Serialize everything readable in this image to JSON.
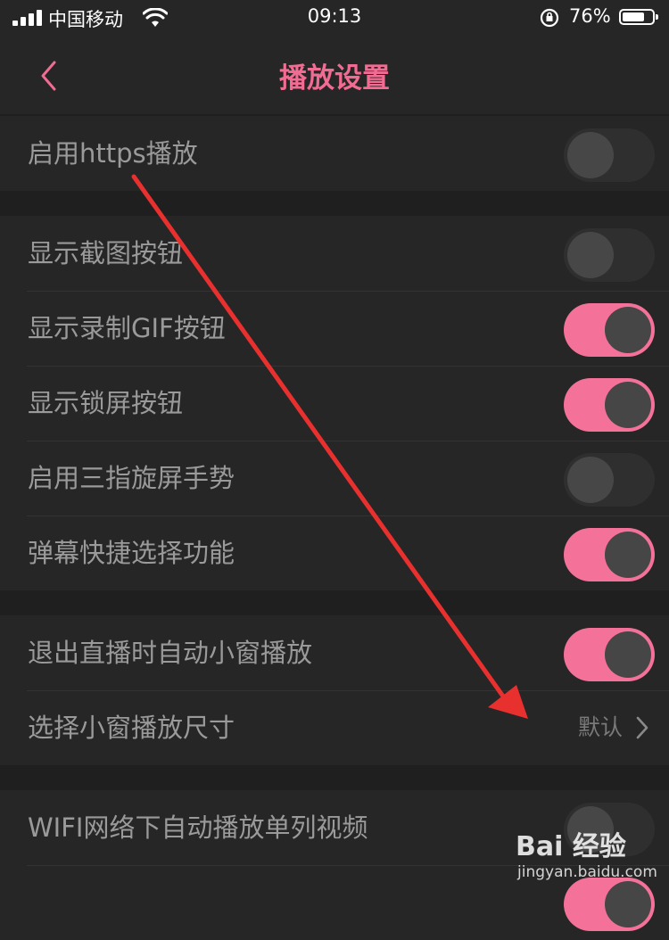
{
  "status_bar": {
    "carrier": "中国移动",
    "time": "09:13",
    "battery_percent": "76%",
    "battery_level": 0.76
  },
  "nav": {
    "title": "播放设置",
    "back_icon": "chevron-left-icon"
  },
  "groups": [
    {
      "rows": [
        {
          "label": "启用https播放",
          "type": "toggle",
          "on": false
        }
      ]
    },
    {
      "rows": [
        {
          "label": "显示截图按钮",
          "type": "toggle",
          "on": false
        },
        {
          "label": "显示录制GIF按钮",
          "type": "toggle",
          "on": true
        },
        {
          "label": "显示锁屏按钮",
          "type": "toggle",
          "on": true
        },
        {
          "label": "启用三指旋屏手势",
          "type": "toggle",
          "on": false
        },
        {
          "label": "弹幕快捷选择功能",
          "type": "toggle",
          "on": true
        }
      ]
    },
    {
      "rows": [
        {
          "label": "退出直播时自动小窗播放",
          "type": "toggle",
          "on": true
        },
        {
          "label": "选择小窗播放尺寸",
          "type": "select",
          "value": "默认"
        }
      ]
    },
    {
      "rows": [
        {
          "label": "WIFI网络下自动播放单列视频",
          "type": "toggle",
          "on": false
        },
        {
          "label": "",
          "type": "toggle",
          "on": true
        }
      ]
    }
  ],
  "watermark": {
    "logo": "Bai 经验",
    "url": "jingyan.baidu.com"
  },
  "colors": {
    "accent": "#f47199",
    "title": "#f26b93",
    "annotation_arrow": "#e8302f"
  }
}
